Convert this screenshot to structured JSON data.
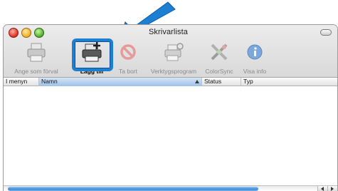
{
  "window": {
    "title": "Skrivarlista"
  },
  "toolbar": {
    "items": [
      {
        "label": "Ange som förval",
        "icon": "default-printer-icon",
        "active": false
      },
      {
        "label": "Lägg till",
        "icon": "add-printer-icon",
        "active": true
      },
      {
        "label": "Ta bort",
        "icon": "delete-icon",
        "active": false
      },
      {
        "label": "Verktygsprogram",
        "icon": "utility-icon",
        "active": false
      },
      {
        "label": "ColorSync",
        "icon": "colorsync-icon",
        "active": false
      },
      {
        "label": "Visa info",
        "icon": "info-icon",
        "active": false
      }
    ]
  },
  "table": {
    "columns": [
      "I menyn",
      "Namn",
      "Status",
      "Typ"
    ],
    "sorted_column": "Namn",
    "rows": []
  },
  "colors": {
    "highlight": "#1d7fd1",
    "callout_arrow": "#1d7fd1",
    "accent": "#3d8ad8"
  }
}
